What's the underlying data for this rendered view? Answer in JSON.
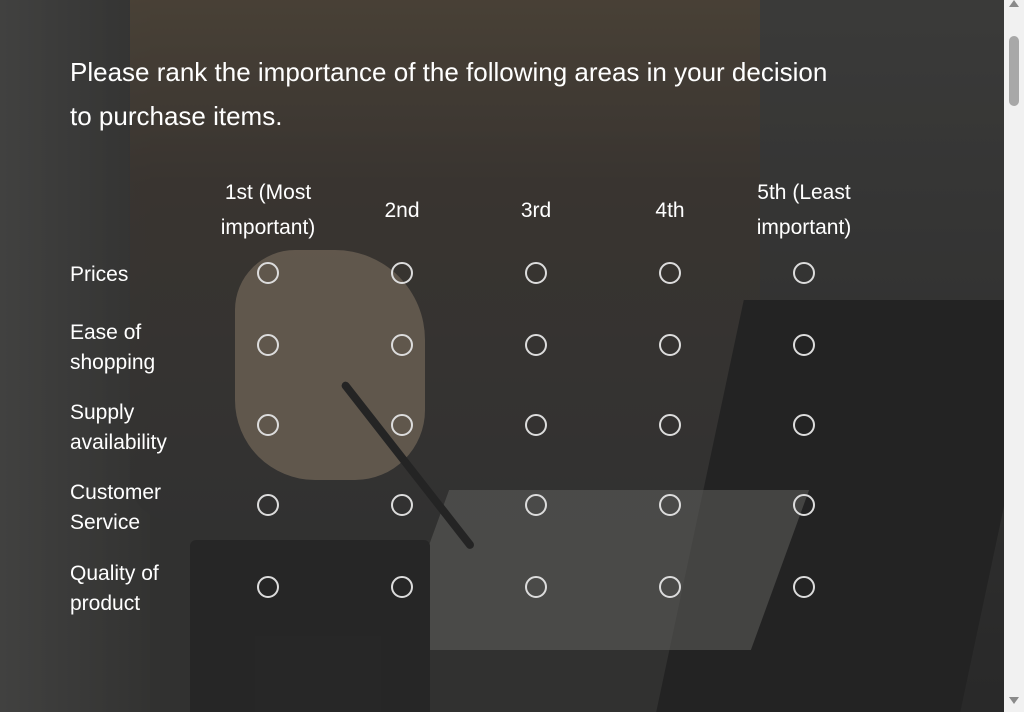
{
  "question": "Please rank the importance of the following areas in your decision to purchase items.",
  "columns": [
    "1st (Most important)",
    "2nd",
    "3rd",
    "4th",
    "5th (Least important)"
  ],
  "rows": [
    "Prices",
    "Ease of shopping",
    "Supply availability",
    "Customer Service",
    "Quality of product"
  ],
  "colors": {
    "overlay": "#282828",
    "text": "#ffffff",
    "radio_border": "#dcdcdc"
  }
}
